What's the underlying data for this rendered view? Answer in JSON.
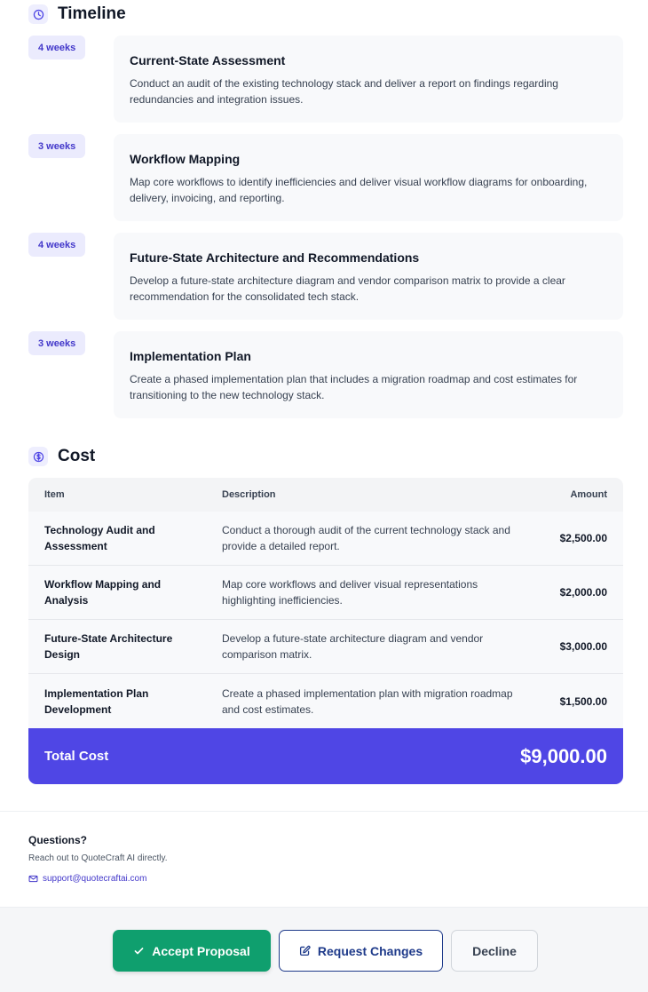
{
  "timeline": {
    "title": "Timeline",
    "icon": "clock-icon",
    "items": [
      {
        "duration": "4 weeks",
        "title": "Current-State Assessment",
        "description": "Conduct an audit of the existing technology stack and deliver a report on findings regarding redundancies and integration issues."
      },
      {
        "duration": "3 weeks",
        "title": "Workflow Mapping",
        "description": "Map core workflows to identify inefficiencies and deliver visual workflow diagrams for onboarding, delivery, invoicing, and reporting."
      },
      {
        "duration": "4 weeks",
        "title": "Future-State Architecture and Recommendations",
        "description": "Develop a future-state architecture diagram and vendor comparison matrix to provide a clear recommendation for the consolidated tech stack."
      },
      {
        "duration": "3 weeks",
        "title": "Implementation Plan",
        "description": "Create a phased implementation plan that includes a migration roadmap and cost estimates for transitioning to the new technology stack."
      }
    ]
  },
  "cost": {
    "title": "Cost",
    "icon": "dollar-icon",
    "headers": {
      "item": "Item",
      "description": "Description",
      "amount": "Amount"
    },
    "rows": [
      {
        "item": "Technology Audit and Assessment",
        "description": "Conduct a thorough audit of the current technology stack and provide a detailed report.",
        "amount": "$2,500.00"
      },
      {
        "item": "Workflow Mapping and Analysis",
        "description": "Map core workflows and deliver visual representations highlighting inefficiencies.",
        "amount": "$2,000.00"
      },
      {
        "item": "Future-State Architecture Design",
        "description": "Develop a future-state architecture diagram and vendor comparison matrix.",
        "amount": "$3,000.00"
      },
      {
        "item": "Implementation Plan Development",
        "description": "Create a phased implementation plan with migration roadmap and cost estimates.",
        "amount": "$1,500.00"
      }
    ],
    "total_label": "Total Cost",
    "total_value": "$9,000.00"
  },
  "questions": {
    "title": "Questions?",
    "subtitle": "Reach out to QuoteCraft AI directly.",
    "email": "support@quotecraftai.com",
    "email_icon": "mail-icon"
  },
  "actions": {
    "accept": "Accept Proposal",
    "request": "Request Changes",
    "decline": "Decline"
  },
  "colors": {
    "accent": "#4f46e5",
    "accept": "#0f9f6e",
    "request": "#1e3a8a"
  }
}
